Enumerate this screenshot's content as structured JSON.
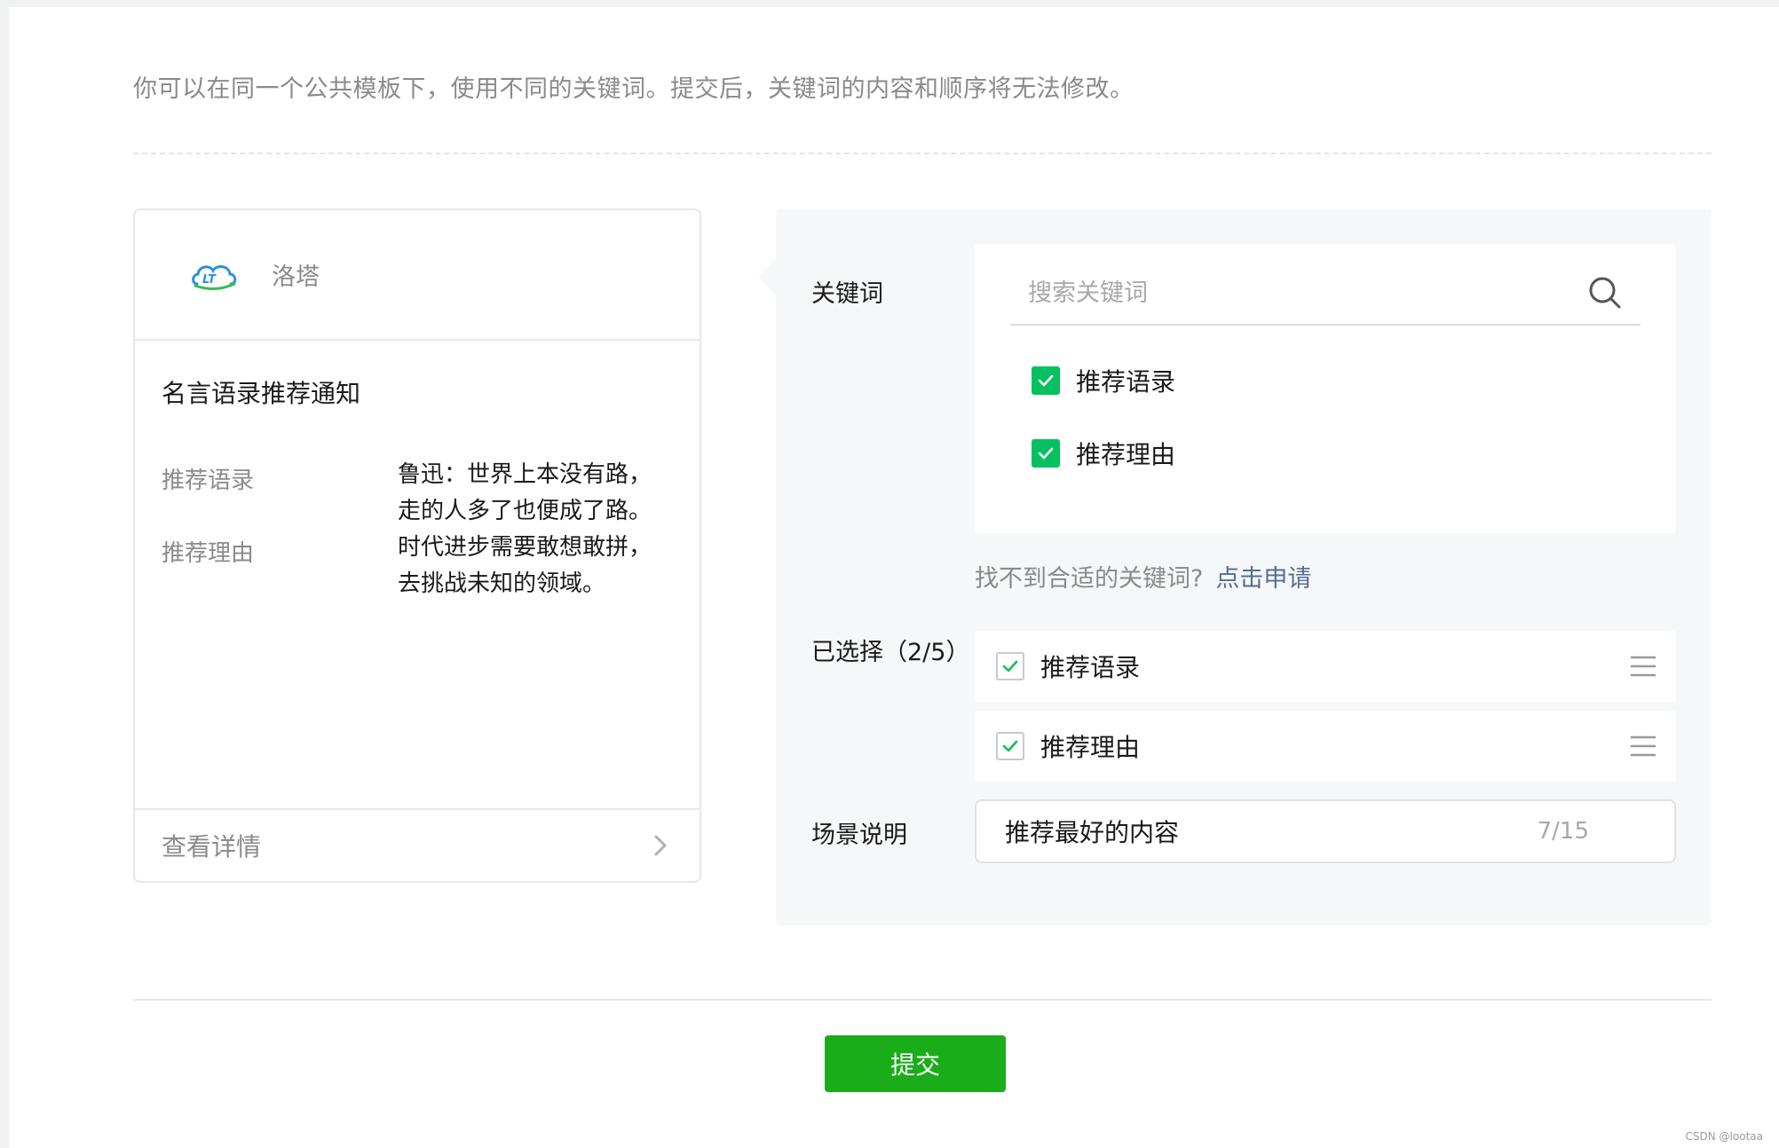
{
  "tip_text": "你可以在同一个公共模板下，使用不同的关键词。提交后，关键词的内容和顺序将无法修改。",
  "preview": {
    "account_name": "洛塔",
    "logo_icon": "lt-cloud-logo",
    "title": "名言语录推荐通知",
    "fields": [
      {
        "label": "推荐语录",
        "value": "鲁迅：世界上本没有路，走的人多了也便成了路。"
      },
      {
        "label": "推荐理由",
        "value": "时代进步需要敢想敢拼，去挑战未知的领域。"
      }
    ],
    "footer_text": "查看详情"
  },
  "keywords": {
    "label": "关键词",
    "search_placeholder": "搜索关键词",
    "options": [
      {
        "label": "推荐语录",
        "checked": true
      },
      {
        "label": "推荐理由",
        "checked": true
      }
    ],
    "hint_text": "找不到合适的关键词?",
    "hint_link": "点击申请"
  },
  "selected": {
    "label": "已选择（2/5）",
    "items": [
      {
        "label": "推荐语录"
      },
      {
        "label": "推荐理由"
      }
    ]
  },
  "scene": {
    "label": "场景说明",
    "value": "推荐最好的内容",
    "count": "7/15"
  },
  "submit_label": "提交",
  "watermark": "CSDN @lootaa",
  "colors": {
    "accent_green": "#1aad19",
    "check_green": "#07c160",
    "link_blue": "#576b95"
  }
}
